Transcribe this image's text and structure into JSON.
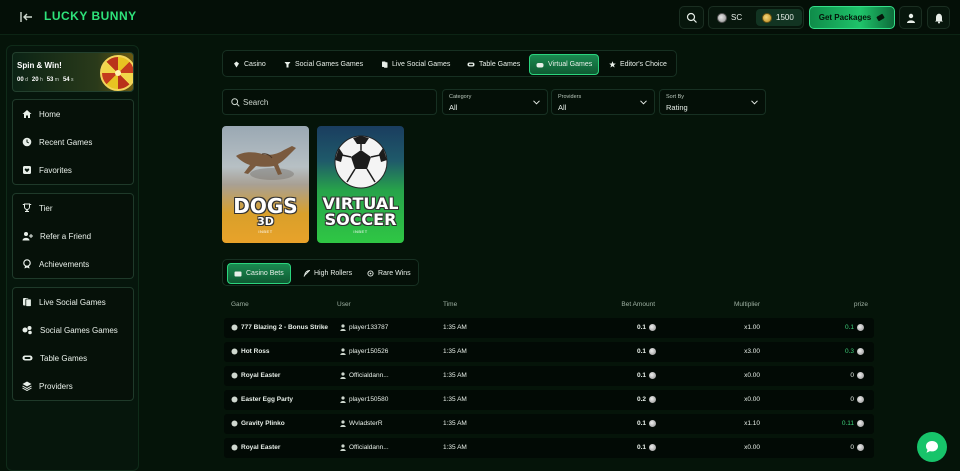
{
  "header": {
    "brand": "LUCKY BUNNY",
    "sc_label": "SC",
    "gc_value": "1500",
    "get_packages": "Get Packages"
  },
  "sidebar": {
    "promo": {
      "title": "Spin & Win!",
      "timer": [
        {
          "value": "00",
          "unit": "d"
        },
        {
          "value": "20",
          "unit": "h"
        },
        {
          "value": "53",
          "unit": "m"
        },
        {
          "value": "54",
          "unit": "s"
        }
      ]
    },
    "group1": [
      "Home",
      "Recent Games",
      "Favorites"
    ],
    "group2": [
      "Tier",
      "Refer a Friend",
      "Achievements"
    ],
    "group3": [
      "Live Social Games",
      "Social Games Games",
      "Table Games",
      "Providers"
    ]
  },
  "categories": {
    "tabs": [
      "Casino",
      "Social Games Games",
      "Live Social Games",
      "Table Games",
      "Virtual Games",
      "Editor's Choice"
    ],
    "active": "Virtual Games"
  },
  "filters": {
    "search_placeholder": "Search",
    "category": {
      "label": "Category",
      "value": "All"
    },
    "providers": {
      "label": "Providers",
      "value": "All"
    },
    "sort": {
      "label": "Sort By",
      "value": "Rating"
    }
  },
  "games": [
    {
      "line1": "DOGS",
      "line2": "3D",
      "sub": "INBET"
    },
    {
      "line1": "VIRTUAL",
      "line2": "SOCCER",
      "sub": "INBET"
    }
  ],
  "bets": {
    "tabs": [
      "Casino Bets",
      "High Rollers",
      "Rare Wins"
    ],
    "active": "Casino Bets",
    "columns": [
      "Game",
      "User",
      "Time",
      "Bet Amount",
      "Multiplier",
      "prize"
    ],
    "rows": [
      {
        "game": "777 Blazing 2 - Bonus Strike",
        "user": "player133787",
        "time": "1:35 AM",
        "bet": "0.1",
        "mult": "x1.00",
        "prize": "0.1",
        "win": true
      },
      {
        "game": "Hot Ross",
        "user": "player150526",
        "time": "1:35 AM",
        "bet": "0.1",
        "mult": "x3.00",
        "prize": "0.3",
        "win": true
      },
      {
        "game": "Royal Easter",
        "user": "Officialdann...",
        "time": "1:35 AM",
        "bet": "0.1",
        "mult": "x0.00",
        "prize": "0",
        "win": false
      },
      {
        "game": "Easter Egg Party",
        "user": "player150580",
        "time": "1:35 AM",
        "bet": "0.2",
        "mult": "x0.00",
        "prize": "0",
        "win": false
      },
      {
        "game": "Gravity Plinko",
        "user": "WvladsterR",
        "time": "1:35 AM",
        "bet": "0.1",
        "mult": "x1.10",
        "prize": "0.11",
        "win": true
      },
      {
        "game": "Royal Easter",
        "user": "Officialdann...",
        "time": "1:35 AM",
        "bet": "0.1",
        "mult": "x0.00",
        "prize": "0",
        "win": false
      }
    ]
  }
}
